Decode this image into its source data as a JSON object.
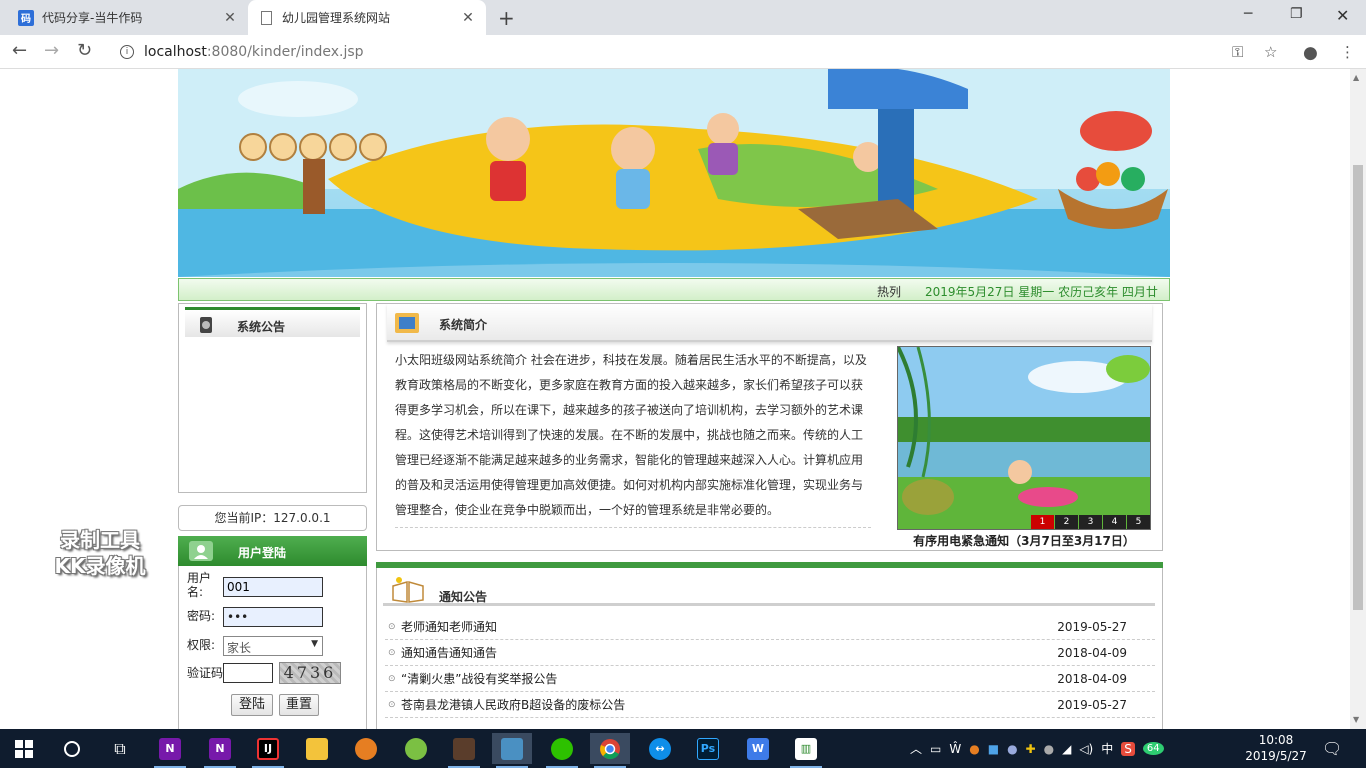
{
  "browser": {
    "tabs": [
      {
        "title": "代码分享-当牛作码",
        "active": false
      },
      {
        "title": "幼儿园管理系统网站",
        "active": true
      }
    ],
    "url_host": "localhost",
    "url_path": ":8080/kinder/index.jsp",
    "window_controls": [
      "minimize",
      "maximize",
      "close"
    ]
  },
  "page": {
    "infobar": {
      "hot_label": "热列",
      "date_text": "2019年5月27日 星期一 农历己亥年 四月廿三"
    },
    "system_notice": {
      "title": "系统公告"
    },
    "ip": {
      "text": "您当前IP：127.0.0.1"
    },
    "login": {
      "title": "用户登陆",
      "username_label": "用户名:",
      "username_value": "001",
      "password_label": "密码:",
      "password_value": "•••",
      "role_label": "权限:",
      "role_value": "家长",
      "captcha_label": "验证码",
      "captcha_text": "4736",
      "login_button": "登陆",
      "reset_button": "重置"
    },
    "intro": {
      "title": "系统简介",
      "text": "小太阳班级网站系统简介 社会在进步，科技在发展。随着居民生活水平的不断提高，以及教育政策格局的不断变化，更多家庭在教育方面的投入越来越多，家长们希望孩子可以获得更多学习机会，所以在课下，越来越多的孩子被送向了培训机构，去学习额外的艺术课程。这使得艺术培训得到了快速的发展。在不断的发展中，挑战也随之而来。传统的人工管理已经逐渐不能满足越来越多的业务需求，智能化的管理越来越深入人心。计算机应用的普及和灵活运用使得管理更加高效便捷。如何对机构内部实施标准化管理，实现业务与管理整合，使企业在竞争中脱颖而出，一个好的管理系统是非常必要的。",
      "photo_pages": [
        "1",
        "2",
        "3",
        "4",
        "5"
      ],
      "photo_active_page": "1",
      "photo_caption": "有序用电紧急通知（3月7日至3月17日）"
    },
    "notices": {
      "title": "通知公告",
      "items": [
        {
          "title": "老师通知老师通知",
          "date": "2019-05-27"
        },
        {
          "title": "通知通告通知通告",
          "date": "2018-04-09"
        },
        {
          "title": "“清剿火患”战役有奖举报公告",
          "date": "2018-04-09"
        },
        {
          "title": "苍南县龙港镇人民政府B超设备的废标公告",
          "date": "2019-05-27"
        }
      ]
    }
  },
  "watermark": {
    "line1": "录制工具",
    "line2": "KK录像机"
  },
  "taskbar": {
    "apps": [
      "onenote-icon",
      "onenote-2-icon",
      "intellij-icon",
      "file-explorer-icon",
      "app-orange-icon",
      "app-green-icon",
      "app-dark-icon",
      "app-blue-icon",
      "wechat-icon",
      "chrome-icon",
      "teamviewer-icon",
      "photoshop-icon",
      "wps-icon",
      "app-chart-icon"
    ],
    "ime": "中",
    "battery_badge": "64",
    "time": "10:08",
    "date": "2019/5/27"
  },
  "colors": {
    "accent_green": "#2e8b2e",
    "date_green": "#2d8d2d",
    "taskbar_bg": "#0f1c2e",
    "tab_strip": "#dee1e6"
  }
}
